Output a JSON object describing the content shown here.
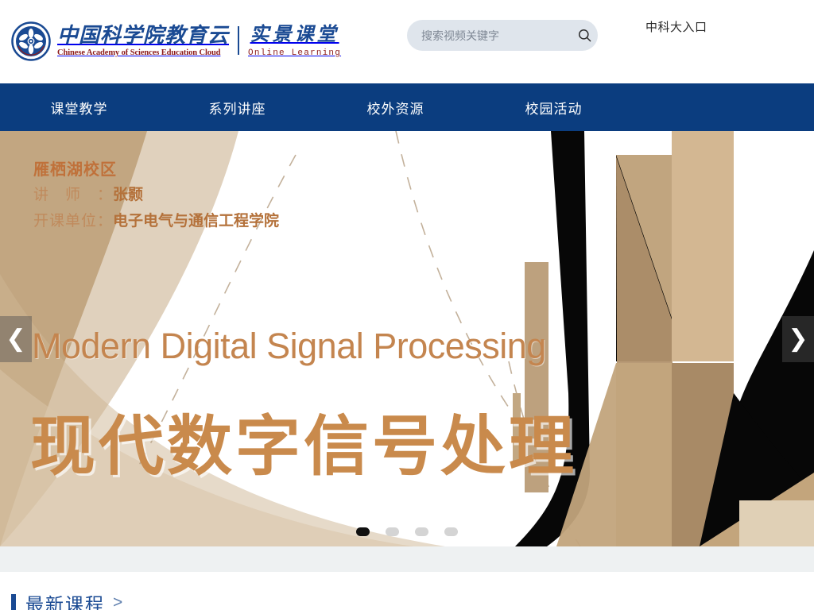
{
  "site": {
    "brand_cn": "中国科学院教育云",
    "brand_en": "Chinese Academy of Sciences Education Cloud",
    "brand_sub_cn": "实景课堂",
    "brand_sub_en": "Online  Learning",
    "emblem_icon": "cas-emblem-icon"
  },
  "search": {
    "placeholder": "搜索视频关键字",
    "value": "",
    "icon": "search-icon"
  },
  "header": {
    "entry_link": "中科大入口"
  },
  "nav": {
    "items": [
      {
        "label": "课堂教学"
      },
      {
        "label": "系列讲座"
      },
      {
        "label": "校外资源"
      },
      {
        "label": "校园活动"
      }
    ]
  },
  "banner": {
    "campus": "雁栖湖校区",
    "teacher_label": "讲　师　：",
    "teacher_name": "张颢",
    "dept_label": "开课单位：",
    "dept_name": "电子电气与通信工程学院",
    "title_en": "Modern Digital Signal Processing",
    "title_cn": "现代数字信号处理",
    "prev_icon": "chevron-left-icon",
    "next_icon": "chevron-right-icon",
    "prev_glyph": "❮",
    "next_glyph": "❯",
    "dots": [
      {
        "active": true
      },
      {
        "active": false
      },
      {
        "active": false
      },
      {
        "active": false
      }
    ],
    "colors": {
      "accent_orange": "#c4854f",
      "accent_title": "#c98a4c",
      "tan_light": "#cdb391",
      "tan_mid": "#b99b78",
      "tan_dark": "#a1825f",
      "black": "#0a0a0a"
    }
  },
  "latest": {
    "title": "最新课程",
    "more": ">"
  },
  "theme": {
    "nav_blue": "#0b3d7f",
    "brand_blue": "#1a4a93",
    "brand_red": "#8c1b1b",
    "search_bg": "#dfe5ec",
    "gray_band": "#eef1f2"
  }
}
